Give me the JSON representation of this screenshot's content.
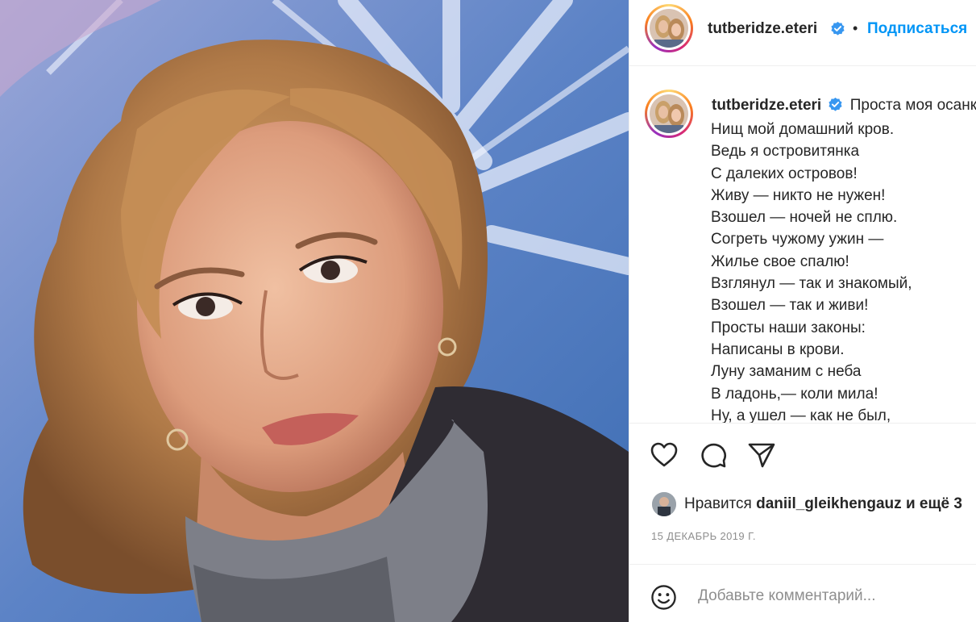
{
  "post": {
    "username": "tutberidze.eteri",
    "follow_label": "Подписаться",
    "separator": "•",
    "caption_first": "Проста моя осанка,",
    "caption_lines": [
      "Нищ мой домашний кров.",
      "Ведь я островитянка",
      "С далеких островов!",
      "Живу — никто не нужен!",
      "Взошел — ночей не сплю.",
      "Согреть чужому ужин —",
      "Жилье свое спалю!",
      "Взглянул — так и знакомый,",
      "Взошел — так и живи!",
      "Просты наши законы:",
      "Написаны в крови.",
      "Луну заманим с неба",
      "В ладонь,— коли мила!",
      "Ну, а ушел — как не был,"
    ],
    "likes_prefix": "Нравится",
    "likes_user": "daniil_gleikhengauz",
    "likes_suffix": "и ещё 3",
    "date": "15 ДЕКАБРЬ 2019 Г.",
    "comment_placeholder": "Добавьте комментарий...",
    "verified_color": "#3897f0",
    "link_color": "#0095f6"
  },
  "icons": {
    "like": "heart-icon",
    "comment": "comment-bubble-icon",
    "share": "paper-plane-icon",
    "emoji": "smiley-icon",
    "verified": "verified-badge-icon"
  }
}
